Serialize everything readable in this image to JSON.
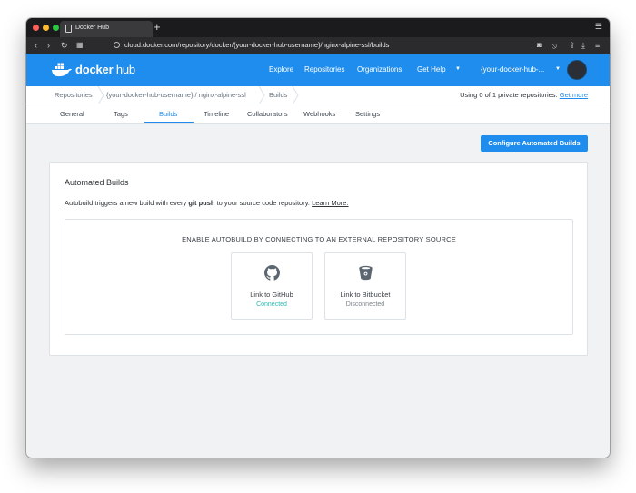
{
  "browser": {
    "tab_title": "Docker Hub",
    "new_tab": "+",
    "url": "cloud.docker.com/repository/docker/{your-docker-hub-username}/nginx-alpine-ssl/builds"
  },
  "header": {
    "logo_word1": "docker",
    "logo_word2": " hub",
    "nav": [
      "Explore",
      "Repositories",
      "Organizations",
      "Get Help"
    ],
    "username": "{your-docker-hub-...",
    "brand_color": "#1f8ded"
  },
  "breadcrumb": {
    "items": [
      "Repositories",
      "{your-docker-hub-username} / nginx-alpine-ssl",
      "Builds"
    ],
    "usage_text": "Using 0 of 1 private repositories.",
    "usage_link": "Get more"
  },
  "tabs": [
    "General",
    "Tags",
    "Builds",
    "Timeline",
    "Collaborators",
    "Webhooks",
    "Settings"
  ],
  "active_tab": "Builds",
  "configure_button": "Configure Automated Builds",
  "card": {
    "title": "Automated Builds",
    "desc_prefix": "Autobuild triggers a new build with every ",
    "desc_bold": "git push",
    "desc_suffix": " to your source code repository. ",
    "desc_link": "Learn More.",
    "section_title": "ENABLE AUTOBUILD BY CONNECTING TO AN EXTERNAL REPOSITORY SOURCE",
    "sources": [
      {
        "label": "Link to GitHub",
        "status": "Connected",
        "icon": "github-icon"
      },
      {
        "label": "Link to Bitbucket",
        "status": "Disconnected",
        "icon": "bitbucket-icon"
      }
    ],
    "connected_color": "#2bb8b0"
  }
}
